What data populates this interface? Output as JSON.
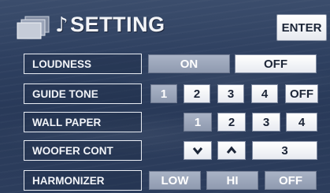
{
  "header": {
    "title": "SETTING",
    "note_symbol": "♪",
    "enter_label": "ENTER"
  },
  "rows": {
    "loudness": {
      "label": "LOUDNESS",
      "on": "ON",
      "off": "OFF",
      "selected": "ON"
    },
    "guide_tone": {
      "label": "GUIDE TONE",
      "options": [
        "1",
        "2",
        "3",
        "4",
        "OFF"
      ],
      "selected": "1"
    },
    "wall_paper": {
      "label": "WALL PAPER",
      "options": [
        "1",
        "2",
        "3",
        "4"
      ],
      "selected": "1"
    },
    "woofer_cont": {
      "label": "WOOFER CONT",
      "value": "3",
      "down_icon": "chevron-down-icon",
      "up_icon": "chevron-up-icon"
    },
    "harmonizer": {
      "label": "HARMONIZER",
      "options": [
        "LOW",
        "HI",
        "OFF"
      ]
    }
  },
  "colors": {
    "background": "#2e4060",
    "selected": "#9aa4b8",
    "button": "#ffffff"
  }
}
